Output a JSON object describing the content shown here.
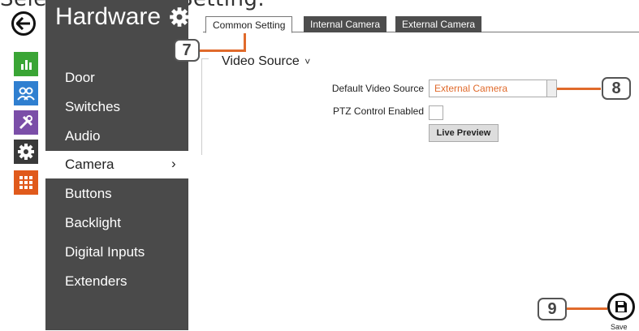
{
  "caption": "Select Common Setting.",
  "sidebar": {
    "title": "Hardware",
    "items": [
      "Door",
      "Switches",
      "Audio",
      "Camera",
      "Buttons",
      "Backlight",
      "Digital Inputs",
      "Extenders"
    ],
    "active_item": "Camera",
    "active_chevron": "›"
  },
  "rail_icons": [
    {
      "name": "chart-icon",
      "color": "#3aa535"
    },
    {
      "name": "users-icon",
      "color": "#2f7fd0"
    },
    {
      "name": "tools-icon",
      "color": "#7b4ea8"
    },
    {
      "name": "gear-icon",
      "color": "#3a3a3a"
    },
    {
      "name": "grid-icon",
      "color": "#e05a1c"
    }
  ],
  "tabs": [
    "Common Setting",
    "Internal Camera",
    "External Camera"
  ],
  "callouts": {
    "c7": "7",
    "c8": "8",
    "c9": "9"
  },
  "section": {
    "title": "Video Source",
    "chevron": "˅",
    "default_source_label": "Default Video Source",
    "default_source_value": "External Camera",
    "ptz_label": "PTZ Control Enabled",
    "live_preview": "Live Preview"
  },
  "save": {
    "label": "Save"
  },
  "colors": {
    "sidebar": "#4a4a4a",
    "accent": "#e06a2b"
  }
}
